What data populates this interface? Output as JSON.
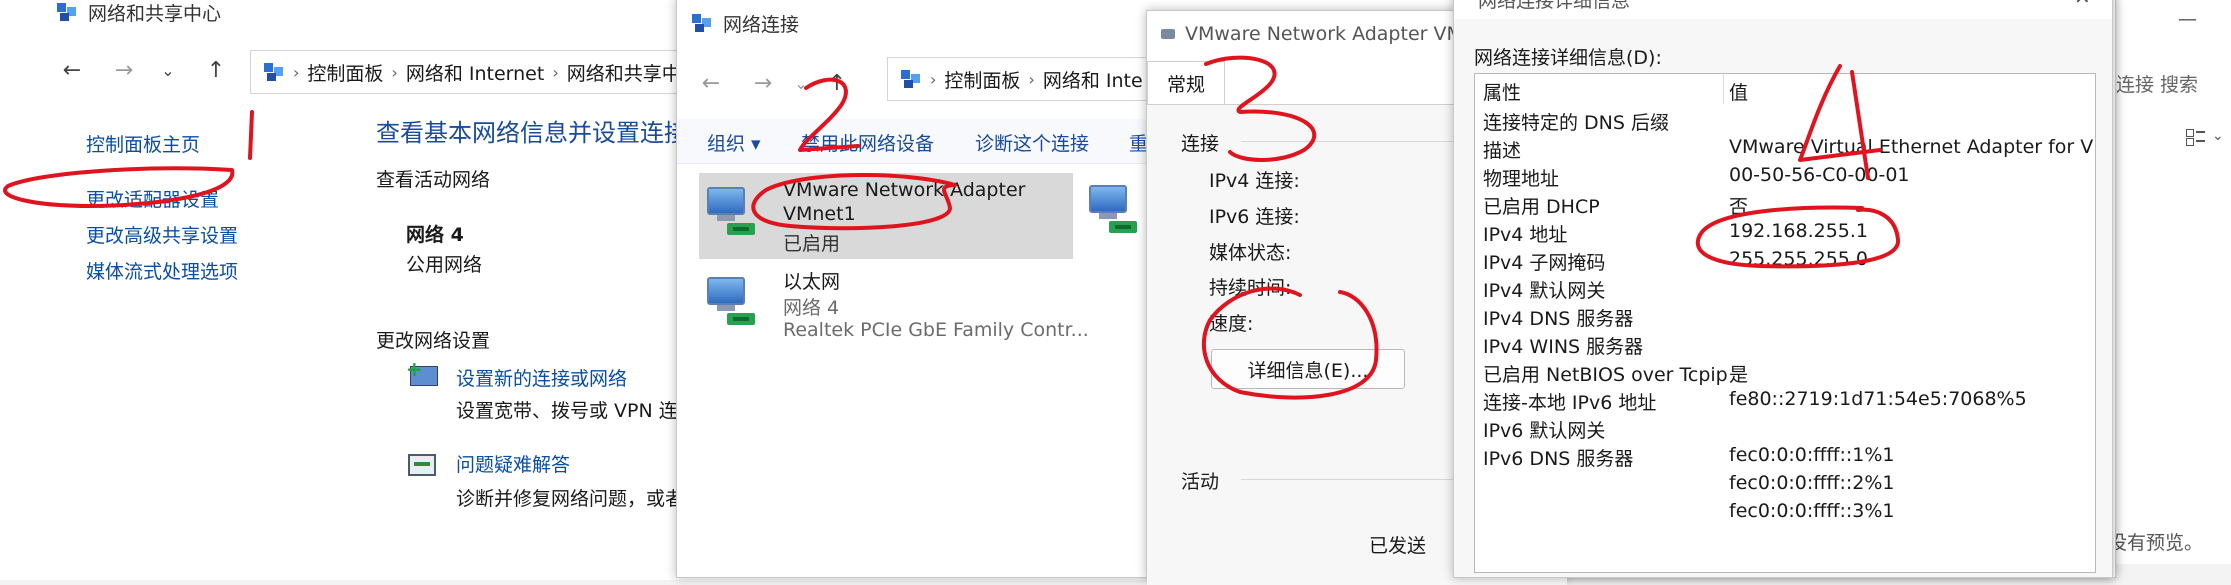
{
  "sharing_center": {
    "title": "网络和共享中心",
    "breadcrumb": [
      "控制面板",
      "网络和 Internet",
      "网络和共享中"
    ],
    "sidebar": [
      "控制面板主页",
      "更改适配器设置",
      "更改高级共享设置",
      "媒体流式处理选项"
    ],
    "heading": "查看基本网络信息并设置连接",
    "active_networks_label": "查看活动网络",
    "network_name": "网络 4",
    "network_type": "公用网络",
    "change_settings_label": "更改网络设置",
    "tasks": [
      {
        "title": "设置新的连接或网络",
        "desc": "设置宽带、拨号或 VPN 连接"
      },
      {
        "title": "问题疑难解答",
        "desc": "诊断并修复网络问题，或者获"
      }
    ]
  },
  "connections": {
    "title": "网络连接",
    "breadcrumb": [
      "控制面板",
      "网络和 Inte"
    ],
    "toolbar": [
      "组织 ▾",
      "禁用此网络设备",
      "诊断这个连接",
      "重"
    ],
    "adapters": [
      {
        "name_line1": "VMware Network Adapter",
        "name_line2": "VMnet1",
        "status": "已启用",
        "device": ""
      },
      {
        "name_line1": "以太网",
        "name_line2": "",
        "status": "网络 4",
        "device": "Realtek PCIe GbE Family Contr..."
      }
    ]
  },
  "status_dialog": {
    "title": "VMware Network Adapter VMnet",
    "tab": "常规",
    "connection_group": "连接",
    "fields": [
      "IPv4 连接:",
      "IPv6 连接:",
      "媒体状态:",
      "持续时间:",
      "速度:"
    ],
    "details_button": "详细信息(E)...",
    "activity_group": "活动",
    "sent_label": "已发送"
  },
  "details_dialog": {
    "title": "网络连接详细信息",
    "label": "网络连接详细信息(D):",
    "col_property": "属性",
    "col_value": "值",
    "rows": [
      {
        "k": "连接特定的 DNS 后缀",
        "v": ""
      },
      {
        "k": "描述",
        "v": "VMware Virtual Ethernet Adapter for VMn"
      },
      {
        "k": "物理地址",
        "v": "00-50-56-C0-00-01"
      },
      {
        "k": "已启用 DHCP",
        "v": "否"
      },
      {
        "k": "IPv4 地址",
        "v": "192.168.255.1"
      },
      {
        "k": "IPv4 子网掩码",
        "v": "255.255.255.0"
      },
      {
        "k": "IPv4 默认网关",
        "v": ""
      },
      {
        "k": "IPv4 DNS 服务器",
        "v": ""
      },
      {
        "k": "IPv4 WINS 服务器",
        "v": ""
      },
      {
        "k": "已启用 NetBIOS over Tcpip",
        "v": "是"
      },
      {
        "k": "连接-本地 IPv6 地址",
        "v": "fe80::2719:1d71:54e5:7068%5"
      },
      {
        "k": "IPv6 默认网关",
        "v": ""
      },
      {
        "k": "IPv6 DNS 服务器",
        "v": "fec0:0:0:ffff::1%1"
      },
      {
        "k": "",
        "v": "fec0:0:0:ffff::2%1"
      },
      {
        "k": "",
        "v": "fec0:0:0:ffff::3%1"
      }
    ]
  },
  "right_edge": {
    "search_text": "连接 搜索",
    "preview_text": "没有预览。",
    "minimize_glyph": "—"
  },
  "annotations": [
    "1",
    "2",
    "3",
    "4"
  ],
  "colors": {
    "link": "#0a4ea3",
    "annotation_red": "#e0141e",
    "selection": "#d9d9d9"
  }
}
